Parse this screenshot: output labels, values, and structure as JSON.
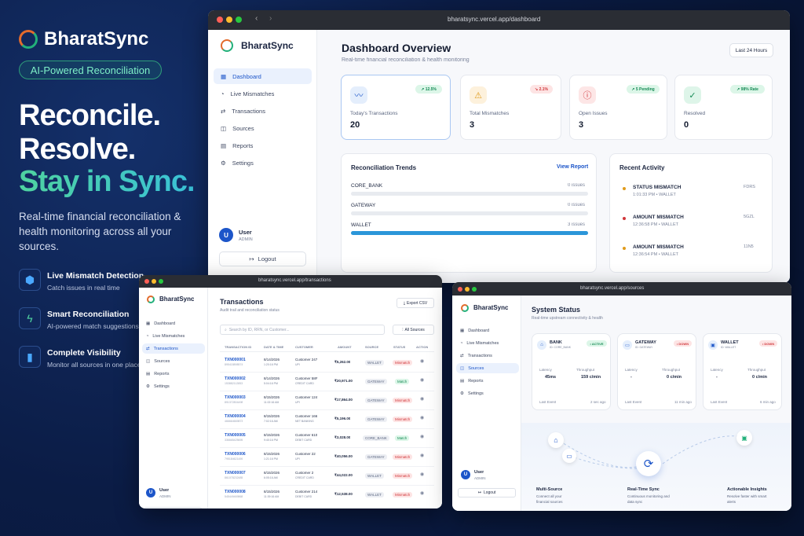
{
  "hero": {
    "brand": "BharatSync",
    "pill": "AI-Powered Reconciliation",
    "headline": [
      "Reconcile.",
      "Resolve.",
      "Stay in Sync."
    ],
    "subtitle": "Real-time financial reconciliation & health monitoring across all your sources.",
    "features": [
      {
        "title": "Live Mismatch Detection",
        "desc": "Catch issues in real time",
        "icon": "cube-icon"
      },
      {
        "title": "Smart Reconciliation",
        "desc": "AI-powered match suggestions",
        "icon": "bolt-icon"
      },
      {
        "title": "Complete Visibility",
        "desc": "Monitor all sources in one place",
        "icon": "bar-chart-icon"
      }
    ]
  },
  "colors": {
    "accent": "#1c55c9",
    "green": "#22b07a",
    "orange": "#e36b2c",
    "red": "#d0363a"
  },
  "nav": [
    "Dashboard",
    "Live Mismatches",
    "Transactions",
    "Sources",
    "Reports",
    "Settings"
  ],
  "user": {
    "name": "User",
    "role": "ADMIN",
    "initial": "U",
    "logout": "Logout"
  },
  "dashboard": {
    "url": "bharatsync.vercel.app/dashboard",
    "title": "Dashboard Overview",
    "subtitle": "Real-time financial reconciliation & health monitoring",
    "range": "Last 24 Hours",
    "stats": [
      {
        "label": "Today's Transactions",
        "value": "20",
        "badge": "↗ 12.5%"
      },
      {
        "label": "Total Mismatches",
        "value": "3",
        "badge": "↘ 2.1%"
      },
      {
        "label": "Open Issues",
        "value": "3",
        "badge": "↗ 5 Pending"
      },
      {
        "label": "Resolved",
        "value": "0",
        "badge": "↗ 98% Rate"
      }
    ],
    "trends": {
      "title": "Reconciliation Trends",
      "link": "View Report",
      "rows": [
        {
          "name": "CORE_BANK",
          "issues": "0 issues",
          "progress": 0
        },
        {
          "name": "GATEWAY",
          "issues": "0 issues",
          "progress": 0
        },
        {
          "name": "WALLET",
          "issues": "3 issues",
          "progress": 1
        }
      ]
    },
    "activity": {
      "title": "Recent Activity",
      "items": [
        {
          "title": "STATUS MISMATCH",
          "meta": "1:01:33 PM • WALLET",
          "code": "FDRS"
        },
        {
          "title": "AMOUNT MISMATCH",
          "meta": "12:36:58 PM • WALLET",
          "code": "5GZL"
        },
        {
          "title": "AMOUNT MISMATCH",
          "meta": "12:36:54 PM • WALLET",
          "code": "11N5"
        }
      ]
    }
  },
  "transactions": {
    "url": "bharatsync.vercel.app/transactions",
    "title": "Transactions",
    "subtitle": "Audit trail and reconciliation status",
    "export": "Export CSV",
    "search_placeholder": "Search by ID, RRN, or Customer...",
    "filter": "All Sources",
    "columns": [
      "TRANSACTION ID",
      "DATE & TIME",
      "CUSTOMER",
      "AMOUNT",
      "SOURCE",
      "STATUS",
      "ACTION"
    ],
    "rows": [
      {
        "id": "TXN000001",
        "ref": "895418898574",
        "date": "8/14/2026",
        "time": "1:20:16 PM",
        "cust": "Customer 247",
        "method": "UPI",
        "amt": "₹5,262.00",
        "src": "WALLET",
        "status": "Mismatch"
      },
      {
        "id": "TXN000002",
        "ref": "153882112853",
        "date": "8/14/2026",
        "time": "5:04:16 PM",
        "cust": "Customer 58F",
        "method": "CREDIT CARD",
        "amt": "₹20,971.00",
        "src": "GATEWAY",
        "status": "Match"
      },
      {
        "id": "TXN000003",
        "ref": "891372804498",
        "date": "8/15/2026",
        "time": "11:02:16 AM",
        "cust": "Customer 124",
        "method": "UPI",
        "amt": "₹17,864.00",
        "src": "GATEWAY",
        "status": "Mismatch"
      },
      {
        "id": "TXN000004",
        "ref": "466664669873",
        "date": "8/15/2026",
        "time": "7:02:16 AM",
        "cust": "Customer 166",
        "method": "NET BANKING",
        "amt": "₹5,196.00",
        "src": "GATEWAY",
        "status": "Mismatch"
      },
      {
        "id": "TXN000005",
        "ref": "336665425695",
        "date": "8/15/2026",
        "time": "9:40:16 PM",
        "cust": "Customer 610",
        "method": "DEBIT CARD",
        "amt": "₹3,028.00",
        "src": "CORE_BANK",
        "status": "Match"
      },
      {
        "id": "TXN000006",
        "ref": "795184621459",
        "date": "8/15/2026",
        "time": "1:21:16 PM",
        "cust": "Customer 22",
        "method": "UPI",
        "amt": "₹40,056.00",
        "src": "GATEWAY",
        "status": "Mismatch"
      },
      {
        "id": "TXN000007",
        "ref": "861078232485",
        "date": "8/15/2026",
        "time": "6:05:16 AM",
        "cust": "Customer 2",
        "method": "CREDIT CARD",
        "amt": "₹44,022.00",
        "src": "WALLET",
        "status": "Mismatch"
      },
      {
        "id": "TXN000008",
        "ref": "545449469868",
        "date": "8/15/2026",
        "time": "11:39:16 AM",
        "cust": "Customer 214",
        "method": "DEBIT CARD",
        "amt": "₹12,538.00",
        "src": "WALLET",
        "status": "Mismatch"
      }
    ]
  },
  "sources": {
    "url": "bharatsync.vercel.app/sources",
    "title": "System Status",
    "subtitle": "Real-time upstream connectivity & health",
    "cards": [
      {
        "name": "BANK",
        "id": "ID: CORE_BANK",
        "status": "• ACTIVE",
        "latency": "45ms",
        "throughput": "159 c/min",
        "last": "2 sec ago"
      },
      {
        "name": "GATEWAY",
        "id": "ID: GATEWAY",
        "status": "• DOWN",
        "latency": "-",
        "throughput": "0 c/min",
        "last": "11 min ago"
      },
      {
        "name": "WALLET",
        "id": "ID: WALLET",
        "status": "• DOWN",
        "latency": "-",
        "throughput": "0 c/min",
        "last": "6 min ago"
      }
    ],
    "labels": {
      "latency": "Latency",
      "throughput": "Throughput",
      "last": "Last Event"
    },
    "features": [
      {
        "title": "Multi-Source",
        "desc": "Connect all your financial sources"
      },
      {
        "title": "Real-Time Sync",
        "desc": "Continuous monitoring and data sync"
      },
      {
        "title": "Actionable Insights",
        "desc": "Resolve faster with smart alerts"
      }
    ]
  }
}
